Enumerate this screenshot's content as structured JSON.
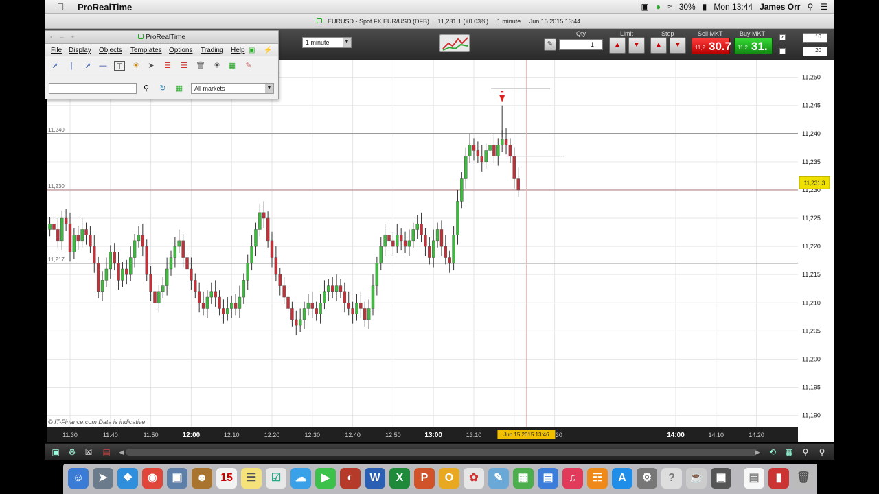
{
  "menubar": {
    "app_name": "ProRealTime",
    "battery": "30%",
    "clock": "Mon 13:44",
    "user": "James Orr"
  },
  "window": {
    "instrument": "EURUSD - Spot FX EUR/USD (DFB)",
    "price": "11,231.1 (+0.03%)",
    "interval": "1 minute",
    "datetime": "Jun 15 2015 13:44"
  },
  "toolbar": {
    "timeframe": "1 minute",
    "qty_label": "Qty",
    "qty_value": "1",
    "limit_label": "Limit",
    "stop_label": "Stop",
    "sell_label": "Sell MKT",
    "buy_label": "Buy MKT",
    "sell_small": "11,2",
    "sell_big": "30.7",
    "buy_small": "11,2",
    "buy_big": "31.",
    "field_a": "10",
    "field_b": "20"
  },
  "panel": {
    "title": "ProRealTime",
    "menu": [
      "File",
      "Display",
      "Objects",
      "Templates",
      "Options",
      "Trading",
      "Help"
    ],
    "markets": "All markets"
  },
  "chart": {
    "watermark": "© IT-Finance.com  Data is indicative",
    "cursor_time": "Jun 15 2015 13:46",
    "current_price_label": "11,231.3",
    "hline_labels": [
      "11,240",
      "11,230",
      "11,217"
    ],
    "colors": {
      "up": "#3fb93f",
      "down": "#c0323a",
      "grid": "#e6e6e6",
      "hline": "#9a9a9a"
    }
  },
  "chart_data": {
    "type": "candlestick",
    "title": "",
    "xlabel": "",
    "ylabel": "",
    "ylim": [
      11188,
      11253
    ],
    "y_ticks": [
      11190,
      11195,
      11200,
      11205,
      11210,
      11215,
      11220,
      11225,
      11230,
      11235,
      11240,
      11245,
      11250
    ],
    "y_tick_labels": [
      "11,190",
      "11,195",
      "11,200",
      "11,205",
      "11,210",
      "11,215",
      "11,220",
      "11,225",
      "11,230",
      "11,235",
      "11,240",
      "11,245",
      "11,250"
    ],
    "x_ticks": [
      "11:30",
      "11:40",
      "11:50",
      "12:00",
      "12:10",
      "12:20",
      "12:30",
      "12:40",
      "12:50",
      "13:00",
      "13:10",
      "13:20",
      "13:30",
      "14:00",
      "14:10",
      "14:20"
    ],
    "x_tick_minutes": [
      690,
      700,
      710,
      720,
      730,
      740,
      750,
      760,
      770,
      780,
      790,
      800,
      810,
      840,
      850,
      860
    ],
    "bold_x_ticks": [
      "12:00",
      "13:00",
      "14:00"
    ],
    "horizontal_lines": [
      11240,
      11230,
      11217
    ],
    "closes": [
      11224,
      11223,
      11221,
      11225,
      11224,
      11219,
      11222,
      11221,
      11223,
      11222,
      11220,
      11217,
      11212,
      11214,
      11216,
      11219,
      11217,
      11214,
      11216,
      11215,
      11218,
      11221,
      11222,
      11220,
      11215,
      11212,
      11210,
      11212,
      11213,
      11216,
      11218,
      11220,
      11221,
      11218,
      11216,
      11214,
      11212,
      11210,
      11209,
      11211,
      11212,
      11211,
      11209,
      11208,
      11209,
      11210,
      11209,
      11211,
      11214,
      11217,
      11220,
      11223,
      11226,
      11225,
      11221,
      11218,
      11215,
      11213,
      11211,
      11209,
      11207,
      11206,
      11207,
      11209,
      11210,
      11209,
      11208,
      11210,
      11212,
      11213,
      11212,
      11213,
      11212,
      11210,
      11209,
      11208,
      11210,
      11209,
      11207,
      11209,
      11213,
      11217,
      11220,
      11222,
      11221,
      11220,
      11222,
      11221,
      11220,
      11221,
      11223,
      11224,
      11222,
      11220,
      11218,
      11221,
      11223,
      11220,
      11218,
      11217,
      11222,
      11228,
      11232,
      11236,
      11238,
      11237,
      11236,
      11235,
      11237,
      11238,
      11236,
      11238,
      11239,
      11238,
      11236,
      11232,
      11230
    ],
    "start_minute": 685
  }
}
